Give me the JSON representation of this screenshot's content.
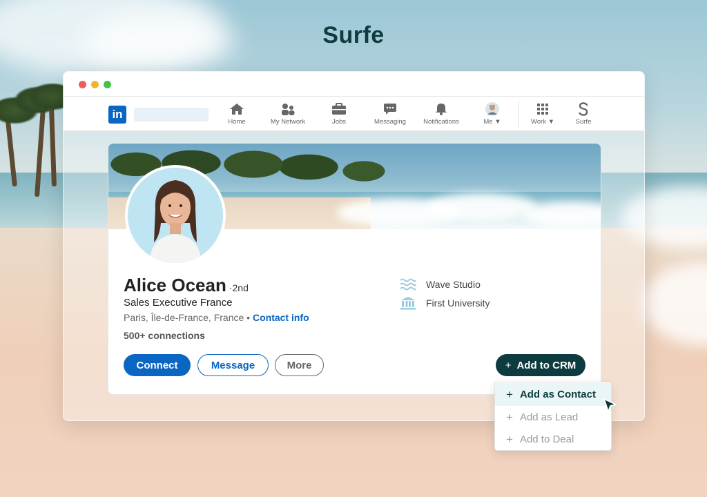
{
  "brand": {
    "title": "Surfe"
  },
  "window": {
    "controls": [
      "close",
      "minimize",
      "maximize"
    ]
  },
  "navbar": {
    "logo": "in",
    "items": [
      {
        "label": "Home",
        "icon": "home-icon"
      },
      {
        "label": "My Network",
        "icon": "network-icon"
      },
      {
        "label": "Jobs",
        "icon": "briefcase-icon"
      },
      {
        "label": "Messaging",
        "icon": "messaging-icon"
      },
      {
        "label": "Notifications",
        "icon": "bell-icon"
      },
      {
        "label": "Me ▼",
        "icon": "avatar-icon"
      },
      {
        "label": "Work ▼",
        "icon": "grid-icon"
      },
      {
        "label": "Surfe",
        "icon": "surfe-icon"
      }
    ]
  },
  "profile": {
    "name": "Alice Ocean",
    "degree": "·2nd",
    "headline": "Sales Executive France",
    "location": "Paris, Île-de-France, France",
    "location_sep": " • ",
    "contact_info": "Contact info",
    "connections": "500+ connections",
    "company": "Wave Studio",
    "school": "First University"
  },
  "actions": {
    "connect": "Connect",
    "message": "Message",
    "more": "More",
    "add_to_crm": "Add to CRM",
    "plus": "+"
  },
  "dropdown": {
    "items": [
      {
        "label": "Add as Contact",
        "active": true
      },
      {
        "label": "Add as Lead",
        "active": false
      },
      {
        "label": "Add to Deal",
        "active": false
      }
    ]
  },
  "colors": {
    "linkedin_blue": "#0a66c2",
    "surfe_dark": "#0e3b3f",
    "icon_light_blue": "#9ccbe0"
  }
}
